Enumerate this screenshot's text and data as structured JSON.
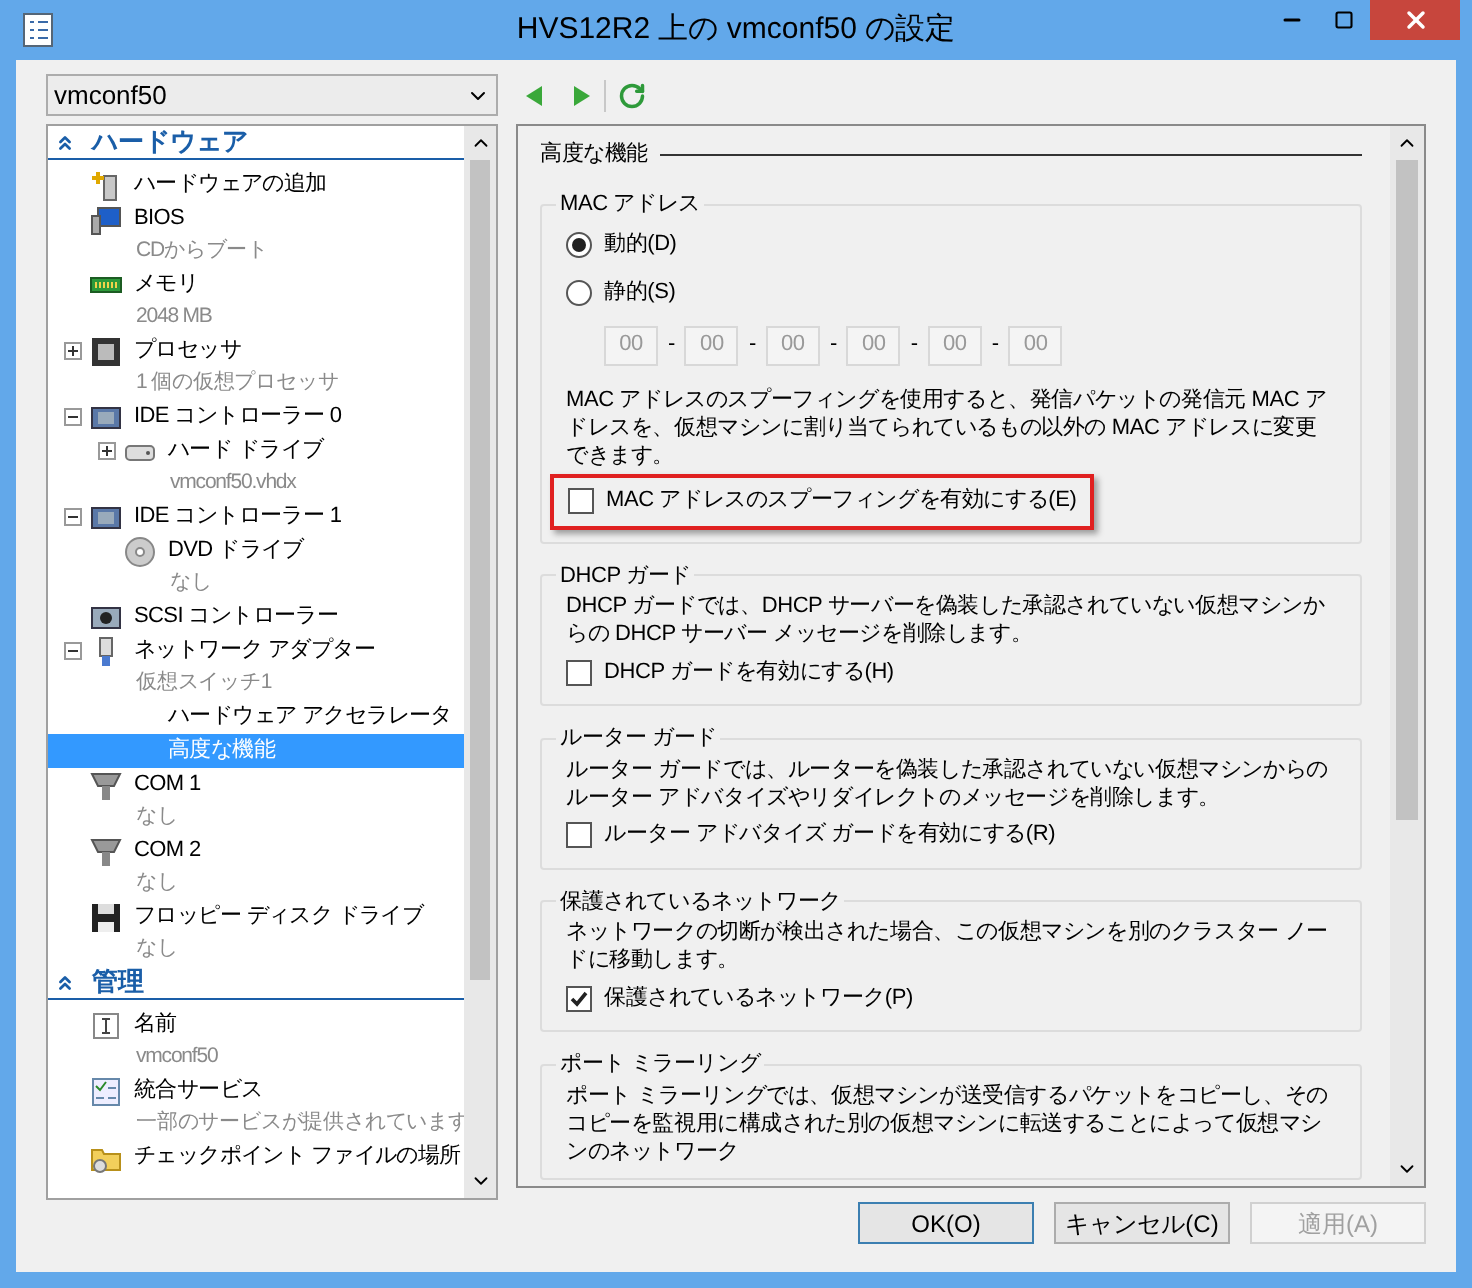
{
  "window": {
    "title": "HVS12R2 上の vmconf50 の設定"
  },
  "vm_selector": {
    "value": "vmconf50"
  },
  "sidebar": {
    "sections": [
      {
        "title": "ハードウェア",
        "expanded": true,
        "items": [
          {
            "kind": "add-hardware",
            "label": "ハードウェアの追加",
            "selected": false
          },
          {
            "kind": "bios",
            "label": "BIOS",
            "detail": "CDからブート",
            "selected": false
          },
          {
            "kind": "memory",
            "label": "メモリ",
            "detail": "2048 MB",
            "selected": false
          },
          {
            "kind": "processor",
            "label": "プロセッサ",
            "detail": "1 個の仮想プロセッサ",
            "expanded": false,
            "selected": false
          },
          {
            "kind": "controller",
            "label": "IDE コントローラー 0",
            "expanded": true,
            "selected": false,
            "children": [
              {
                "kind": "disk",
                "label": "ハード ドライブ",
                "detail": "vmconf50.vhdx",
                "expanded": false,
                "selected": false
              }
            ]
          },
          {
            "kind": "controller",
            "label": "IDE コントローラー 1",
            "expanded": true,
            "selected": false,
            "children": [
              {
                "kind": "dvd",
                "label": "DVD ドライブ",
                "detail": "なし",
                "selected": false
              }
            ]
          },
          {
            "kind": "scsi",
            "label": "SCSI コントローラー",
            "selected": false
          },
          {
            "kind": "network",
            "label": "ネットワーク アダプター",
            "detail": "仮想スイッチ1",
            "expanded": true,
            "selected": false,
            "children": [
              {
                "kind": "plain",
                "label": "ハードウェア アクセラレータ",
                "selected": false
              },
              {
                "kind": "plain",
                "label": "高度な機能",
                "selected": true
              }
            ]
          },
          {
            "kind": "com",
            "label": "COM 1",
            "detail": "なし",
            "selected": false
          },
          {
            "kind": "com",
            "label": "COM 2",
            "detail": "なし",
            "selected": false
          },
          {
            "kind": "floppy",
            "label": "フロッピー ディスク ドライブ",
            "detail": "なし",
            "selected": false
          }
        ]
      },
      {
        "title": "管理",
        "expanded": true,
        "items": [
          {
            "kind": "name",
            "label": "名前",
            "detail": "vmconf50",
            "selected": false
          },
          {
            "kind": "services",
            "label": "統合サービス",
            "detail": "一部のサービスが提供されています",
            "selected": false
          },
          {
            "kind": "checkpoint",
            "label": "チェックポイント ファイルの場所",
            "selected": false
          }
        ]
      }
    ]
  },
  "panel": {
    "title": "高度な機能",
    "groups": [
      {
        "kind": "mac",
        "title": "MAC アドレス",
        "radios": [
          {
            "label": "動的(D)",
            "selected": true
          },
          {
            "label": "静的(S)",
            "selected": false
          }
        ],
        "mac_fields": {
          "disabled": true,
          "parts": [
            {
              "value": "00",
              "separator": "-"
            },
            {
              "value": "00",
              "separator": "-"
            },
            {
              "value": "00",
              "separator": "-"
            },
            {
              "value": "00",
              "separator": "-"
            },
            {
              "value": "00",
              "separator": "-"
            },
            {
              "value": "00"
            }
          ]
        },
        "description": "MAC アドレスのスプーフィングを使用すると、発信パケットの発信元 MAC アドレスを、仮想マシンに割り当てられているもの以外の MAC アドレスに変更できます。",
        "checkbox": {
          "label": "MAC アドレスのスプーフィングを有効にする(E)",
          "checked": false,
          "highlighted": true
        }
      },
      {
        "kind": "option",
        "title": "DHCP ガード",
        "description": "DHCP ガードでは、DHCP サーバーを偽装した承認されていない仮想マシンからの DHCP サーバー メッセージを削除します。",
        "checkbox": {
          "label": "DHCP ガードを有効にする(H)",
          "checked": false,
          "highlighted": false
        }
      },
      {
        "kind": "option",
        "title": "ルーター ガード",
        "description": "ルーター ガードでは、ルーターを偽装した承認されていない仮想マシンからのルーター アドバタイズやリダイレクトのメッセージを削除します。",
        "checkbox": {
          "label": "ルーター アドバタイズ ガードを有効にする(R)",
          "checked": false,
          "highlighted": false
        }
      },
      {
        "kind": "option",
        "title": "保護されているネットワーク",
        "description": "ネットワークの切断が検出された場合、この仮想マシンを別のクラスター ノードに移動します。",
        "checkbox": {
          "label": "保護されているネットワーク(P)",
          "checked": true,
          "highlighted": false
        }
      },
      {
        "kind": "option",
        "title": "ポート ミラーリング",
        "description": "ポート ミラーリングでは、仮想マシンが送受信するパケットをコピーし、そのコピーを監視用に構成された別の仮想マシンに転送することによって仮想マシンのネットワーク"
      }
    ]
  },
  "buttons": [
    {
      "label": "OK(O)",
      "disabled": false,
      "default": true
    },
    {
      "label": "キャンセル(C)",
      "disabled": false,
      "default": false
    },
    {
      "label": "適用(A)",
      "disabled": true,
      "default": false
    }
  ]
}
